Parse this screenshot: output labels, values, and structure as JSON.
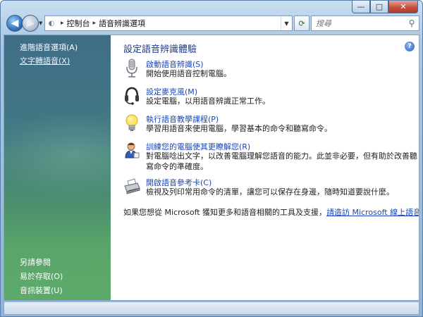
{
  "window": {
    "caption": {
      "minimize": "—",
      "maximize": "□",
      "close": "✕"
    }
  },
  "nav": {
    "back_icon": "back-arrow-icon",
    "forward_icon": "forward-arrow-icon",
    "address": {
      "root_icon": "control-panel-icon",
      "separator": "▸",
      "segments": [
        "控制台",
        "語音辨識選項"
      ]
    },
    "search": {
      "placeholder": "搜尋"
    }
  },
  "sidebar": {
    "links": [
      {
        "label": "進階語音選項(A)"
      },
      {
        "label": "文字轉語音(X)"
      }
    ],
    "see_also": {
      "heading": "另請參閱",
      "links": [
        {
          "label": "易於存取(O)"
        },
        {
          "label": "音訊裝置(U)"
        }
      ]
    }
  },
  "main": {
    "title": "設定語音辨識體驗",
    "tasks": [
      {
        "icon": "microphone-icon",
        "link": "啟動語音辨識(S)",
        "desc": "開始使用語音控制電腦。"
      },
      {
        "icon": "headset-icon",
        "link": "設定麥克風(M)",
        "desc": "設定電腦，以用語音辨識正常工作。"
      },
      {
        "icon": "lightbulb-icon",
        "link": "執行語音教學課程(P)",
        "desc": "學習用語音來使用電腦，學習基本的命令和聽寫命令。"
      },
      {
        "icon": "user-training-icon",
        "link": "訓練您的電腦使其更瞭解您(R)",
        "desc": "對電腦唸出文字，以改善電腦理解您語音的能力。此並非必要，但有助於改善聽寫命令的準確度。"
      },
      {
        "icon": "printer-icon",
        "link": "開啟語音參考卡(C)",
        "desc": "檢視及列印常用命令的清單，讓您可以保存在身邊，隨時知道要說什麼。"
      }
    ],
    "footer": {
      "text": "如果您想從 Microsoft 獲知更多和語音相關的工具及支援，",
      "link": "請造訪 Microsoft 線上語音社群",
      "end": "。"
    }
  },
  "colors": {
    "link": "#1c46b6",
    "title": "#1f3b8c",
    "sidebar_top": "#3f6d86",
    "sidebar_bottom": "#5cab6b"
  }
}
